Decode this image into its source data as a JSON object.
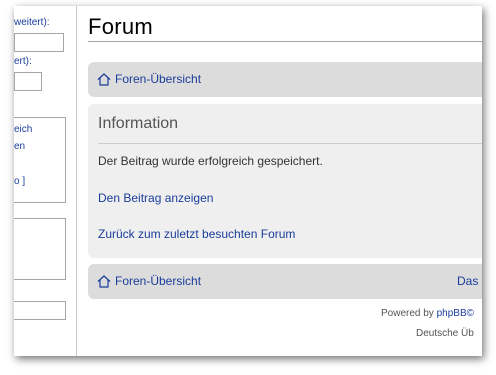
{
  "sidebar": {
    "fragments": [
      "weitert):",
      "ert):",
      "eich",
      "en",
      "o ]"
    ]
  },
  "main": {
    "title": "Forum",
    "nav_top": {
      "home_label": "Foren-Übersicht"
    },
    "info": {
      "heading": "Information",
      "message": "Der Beitrag wurde erfolgreich gespeichert.",
      "link_view_post": "Den Beitrag anzeigen",
      "link_back_forum": "Zurück zum zuletzt besuchten Forum"
    },
    "nav_bottom": {
      "home_label": "Foren-Übersicht",
      "right_label": "Das"
    },
    "footer": {
      "powered_by": "Powered by",
      "brand": "phpBB©",
      "translation": "Deutsche Üb"
    }
  },
  "colors": {
    "link": "#1a3d9a",
    "navbar_bg": "#dcdcdc",
    "panel_bg": "#efefef"
  },
  "icons": {
    "home": "home-icon"
  }
}
